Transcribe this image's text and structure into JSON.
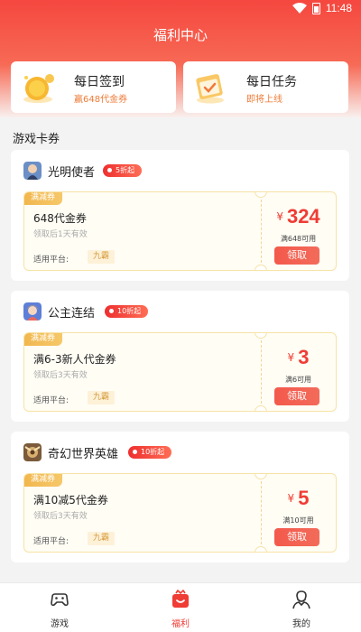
{
  "status": {
    "time": "11:48"
  },
  "header": {
    "title": "福利中心"
  },
  "top_cards": [
    {
      "title": "每日签到",
      "subtitle": "赢648代金券"
    },
    {
      "title": "每日任务",
      "subtitle": "即将上线"
    }
  ],
  "section": {
    "title": "游戏卡券"
  },
  "games": [
    {
      "name": "光明使者",
      "badge": "5折起",
      "coupon": {
        "tag": "满减券",
        "title": "648代金券",
        "validity": "领取后1天有效",
        "platform_label": "适用平台:",
        "platform": "九霸",
        "currency": "¥",
        "amount": "324",
        "condition": "满648可用",
        "button": "领取"
      }
    },
    {
      "name": "公主连结",
      "badge": "10折起",
      "coupon": {
        "tag": "满减券",
        "title": "满6-3新人代金券",
        "validity": "领取后3天有效",
        "platform_label": "适用平台:",
        "platform": "九霸",
        "currency": "¥",
        "amount": "3",
        "condition": "满6可用",
        "button": "领取"
      }
    },
    {
      "name": "奇幻世界英雄",
      "badge": "10折起",
      "coupon": {
        "tag": "满减券",
        "title": "满10减5代金券",
        "validity": "领取后3天有效",
        "platform_label": "适用平台:",
        "platform": "九霸",
        "currency": "¥",
        "amount": "5",
        "condition": "满10可用",
        "button": "领取"
      }
    }
  ],
  "bottom_nav": [
    {
      "label": "游戏",
      "icon": "gamepad-icon",
      "active": false
    },
    {
      "label": "福利",
      "icon": "gift-icon",
      "active": true
    },
    {
      "label": "我的",
      "icon": "user-icon",
      "active": false
    }
  ],
  "colors": {
    "accent": "#ef3c34",
    "header_top": "#f5473f",
    "coupon_tag": "#f1b64d",
    "subtitle_orange": "#ee7b37"
  }
}
